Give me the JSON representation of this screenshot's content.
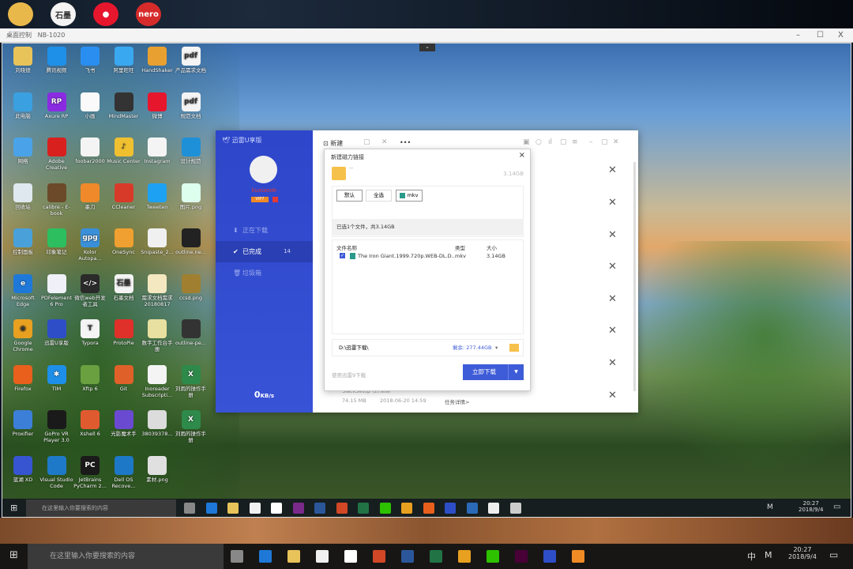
{
  "host_desktop": {
    "icons": [
      {
        "name": "user-folder",
        "color": "#e8b84a",
        "glyph": ""
      },
      {
        "name": "shimo",
        "color": "#f4f4f4",
        "glyph": "石墨"
      },
      {
        "name": "weibo",
        "color": "#e6162d",
        "glyph": "●"
      },
      {
        "name": "nero",
        "color": "#d62b2b",
        "glyph": "nero"
      }
    ]
  },
  "remote_window": {
    "title": "桌面控制",
    "host": "NB-1020",
    "minimize": "–",
    "maximize": "☐",
    "close": "X",
    "collapse": "⌄"
  },
  "desktop_icons": [
    {
      "label": "刘晓德",
      "color": "#e8c35a",
      "glyph": ""
    },
    {
      "label": "此电脑",
      "color": "#3aa0e0",
      "glyph": ""
    },
    {
      "label": "网络",
      "color": "#4aa3e8",
      "glyph": ""
    },
    {
      "label": "回收站",
      "color": "#dfe8ee",
      "glyph": ""
    },
    {
      "label": "控制面板",
      "color": "#4aa0d8",
      "glyph": ""
    },
    {
      "label": "Microsoft Edge",
      "color": "#1e78d7",
      "glyph": "e"
    },
    {
      "label": "Google Chrome",
      "color": "#e8a020",
      "glyph": "◉"
    },
    {
      "label": "Firefox",
      "color": "#e8601c",
      "glyph": ""
    },
    {
      "label": "Proxifier",
      "color": "#3c7fd8",
      "glyph": ""
    },
    {
      "label": "蓝湖 XD",
      "color": "#3755d0",
      "glyph": ""
    },
    {
      "label": "腾讯视频",
      "color": "#1e90e8",
      "glyph": ""
    },
    {
      "label": "Axure RP",
      "color": "#8a2be2",
      "glyph": "RP"
    },
    {
      "label": "Adobe Creative",
      "color": "#d8201e",
      "glyph": ""
    },
    {
      "label": "calibre - E-book",
      "color": "#6b4a2a",
      "glyph": ""
    },
    {
      "label": "印象笔记",
      "color": "#2dbe60",
      "glyph": ""
    },
    {
      "label": "PDFelement 6 Pro",
      "color": "#f0f0f8",
      "glyph": ""
    },
    {
      "label": "迅雷U享版",
      "color": "#2e4ec8",
      "glyph": ""
    },
    {
      "label": "TIM",
      "color": "#1e8fe8",
      "glyph": "✱"
    },
    {
      "label": "GoPro VR Player 3.0",
      "color": "#1a1a1a",
      "glyph": ""
    },
    {
      "label": "Visual Studio Code",
      "color": "#1e7ac8",
      "glyph": ""
    },
    {
      "label": "飞书",
      "color": "#2a8ef0",
      "glyph": ""
    },
    {
      "label": "小画",
      "color": "#fafafa",
      "glyph": ""
    },
    {
      "label": "foobar2000",
      "color": "#f4f4f4",
      "glyph": ""
    },
    {
      "label": "墨刀",
      "color": "#f0892a",
      "glyph": ""
    },
    {
      "label": "Kolor Autopa...",
      "color": "#3a90d8",
      "glyph": "gpg"
    },
    {
      "label": "微信web开发者工具",
      "color": "#2a2a2a",
      "glyph": "</>"
    },
    {
      "label": "Typora",
      "color": "#f4f4f4",
      "glyph": "T"
    },
    {
      "label": "Xftp 6",
      "color": "#6aa040",
      "glyph": ""
    },
    {
      "label": "Xshell 6",
      "color": "#e05a30",
      "glyph": ""
    },
    {
      "label": "JetBrains PyCharm 2...",
      "color": "#1a1a1a",
      "glyph": "PC"
    },
    {
      "label": "阿里旺旺",
      "color": "#3aa8f0",
      "glyph": ""
    },
    {
      "label": "MindMaster",
      "color": "#333",
      "glyph": ""
    },
    {
      "label": "Music Center",
      "color": "#f0c030",
      "glyph": "♪"
    },
    {
      "label": "CCleaner",
      "color": "#d83a2a",
      "glyph": ""
    },
    {
      "label": "OneSync",
      "color": "#f0a030",
      "glyph": ""
    },
    {
      "label": "石墨文档",
      "color": "#f4f4f4",
      "glyph": "石墨"
    },
    {
      "label": "ProtoPie",
      "color": "#e0302a",
      "glyph": ""
    },
    {
      "label": "Git",
      "color": "#e0602a",
      "glyph": ""
    },
    {
      "label": "光影魔术手",
      "color": "#6a4ad0",
      "glyph": ""
    },
    {
      "label": "Dell OS Recove...",
      "color": "#1e78c8",
      "glyph": ""
    },
    {
      "label": "HandShaker",
      "color": "#e8a030",
      "glyph": ""
    },
    {
      "label": "微博",
      "color": "#e6162d",
      "glyph": ""
    },
    {
      "label": "Instagram",
      "color": "#f4f4f4",
      "glyph": ""
    },
    {
      "label": "Tweeten",
      "color": "#1da1f2",
      "glyph": ""
    },
    {
      "label": "Snipaste_2...",
      "color": "#f0f0f0",
      "glyph": ""
    },
    {
      "label": "需求文档需求 20180817",
      "color": "#f4e8c0",
      "glyph": ""
    },
    {
      "label": "数字工作台手册",
      "color": "#e8e0a0",
      "glyph": ""
    },
    {
      "label": "Inoreader Subscripti...",
      "color": "#f4f4f4",
      "glyph": ""
    },
    {
      "label": "38039378...",
      "color": "#dcdcdc",
      "glyph": ""
    },
    {
      "label": "素材.png",
      "color": "#e0e0e0",
      "glyph": ""
    },
    {
      "label": "产品需求文档",
      "color": "#f4f4f4",
      "glyph": "pdf"
    },
    {
      "label": "规范文档",
      "color": "#f4f4f4",
      "glyph": "pdf"
    },
    {
      "label": "设计规范",
      "color": "#1e90d8",
      "glyph": ""
    },
    {
      "label": "图片.png",
      "color": "#dfe",
      "glyph": ""
    },
    {
      "label": "outline.ne...",
      "color": "#222",
      "glyph": ""
    },
    {
      "label": "ccsd.png",
      "color": "#a08030",
      "glyph": ""
    },
    {
      "label": "outline-pe...",
      "color": "#333",
      "glyph": ""
    },
    {
      "label": "刘雨的操作手册",
      "color": "#2e8a4a",
      "glyph": "X"
    },
    {
      "label": "刘雨的操作手册",
      "color": "#2e8a4a",
      "glyph": "X"
    }
  ],
  "app": {
    "name": "迅雷U享版",
    "username": "liuxiaode",
    "vip": "VIP7",
    "speed": "0",
    "speed_unit": "KB/s",
    "nav": [
      {
        "label": "正在下载",
        "icon": "download-icon",
        "count": ""
      },
      {
        "label": "已完成",
        "icon": "check-icon",
        "count": "14"
      },
      {
        "label": "垃圾箱",
        "icon": "trash-icon",
        "count": ""
      }
    ],
    "toolbar": {
      "new": "新建",
      "more": "•••"
    },
    "last_row": {
      "name": "SlackSetup (2).exe",
      "size": "74.15 MB",
      "date": "2018-06-20 14:59",
      "detail": "任务详情>"
    }
  },
  "dialog": {
    "title": "新建磁力链接",
    "close": "×",
    "folder_name": "--",
    "total_size": "3.14GB",
    "filters": {
      "default": "默认",
      "all": "全选",
      "mkv": "mkv"
    },
    "selection_info": "已选1个文件，共3.14GB",
    "columns": {
      "name": "文件名称",
      "type": "类型",
      "size": "大小"
    },
    "files": [
      {
        "name": "The Iron Giant.1999.720p.WEB-DL.D...",
        "type": "mkv",
        "size": "3.14GB",
        "checked": true
      }
    ],
    "path": "D:\\迅雷下载\\",
    "free_space": "剩余: 277.44GB",
    "alt_download": "使用迅雷9下载",
    "download_button": "立即下载"
  },
  "remote_taskbar": {
    "search_placeholder": "在这里输入你要搜索的内容",
    "time": "20:27",
    "date": "2018/9/4",
    "ime": "M"
  },
  "host_taskbar": {
    "search_placeholder": "在这里输入你要搜索的内容",
    "time": "20:27",
    "date": "2018/9/4",
    "ime": "中",
    "ime2": "M"
  }
}
